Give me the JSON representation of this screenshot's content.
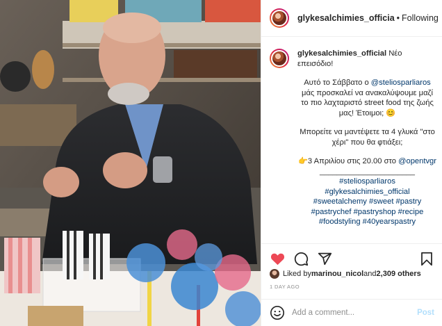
{
  "post": {
    "username": "glykesalchimies_officia",
    "follow_separator": "•",
    "follow_status": "Following",
    "image_alt": "Man preparing lollipops in a kitchen"
  },
  "caption": {
    "username": "glykesalchimies_official",
    "lines": {
      "intro": "Νέο επεισόδιο!",
      "p1_a": "Αυτό το Σάββατο ο ",
      "p1_mention": "@steliosparliaros",
      "p1_b": " μάς προσκαλεί να ανακαλύψουμε μαζί το πιο λαχταριστό street food της ζωής μας! Έτοιμοι;",
      "p2": "Μπορείτε να μαντέψετε τα 4 γλυκά \"στο χέρι\" που θα φτιάξει;",
      "p3_a": "3 Απριλίου στις 20.00 στο ",
      "p3_mention": "@opentvgr",
      "divider": "______________________",
      "tag1": "#steliosparliaros",
      "tag2": "#glykesalchimies_official",
      "tag3": "#sweetalchemy #sweet #pastry",
      "tag4": "#pastrychef #pastryshop #recipe",
      "tag5": "#foodstyling #40yearspastry"
    },
    "emoji_smile": "😊",
    "emoji_point": "👉"
  },
  "actions": {
    "like_icon": "heart-filled-icon",
    "comment_icon": "comment-icon",
    "share_icon": "share-icon",
    "save_icon": "bookmark-icon"
  },
  "likes": {
    "prefix": "Liked by ",
    "user": "marinou_nicol",
    "middle": " and ",
    "count": "2,309 others"
  },
  "timestamp": "1 DAY AGO",
  "comment": {
    "placeholder": "Add a comment...",
    "post_label": "Post"
  },
  "colors": {
    "like_red": "#ed4956",
    "link_blue": "#00376b",
    "post_disabled": "#b2dffc",
    "meta_gray": "#8e8e8e"
  }
}
